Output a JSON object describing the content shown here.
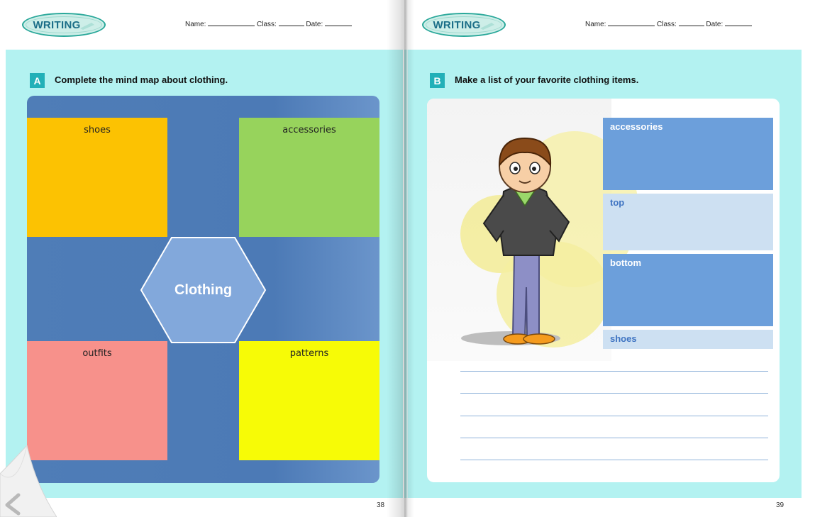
{
  "left_page": {
    "badge": "WRITING",
    "fields": {
      "name": "Name:",
      "class": "Class:",
      "date": "Date:"
    },
    "section_letter": "A",
    "section_title": "Complete the mind map about clothing.",
    "mindmap": {
      "center": "Clothing",
      "boxes": [
        {
          "label": "shoes",
          "color": "#fcc202"
        },
        {
          "label": "accessories",
          "color": "#97d35c"
        },
        {
          "label": "outfits",
          "color": "#f7918b"
        },
        {
          "label": "patterns",
          "color": "#f7fb06"
        }
      ]
    },
    "page_number": "38"
  },
  "right_page": {
    "badge": "WRITING",
    "fields": {
      "name": "Name:",
      "class": "Class:",
      "date": "Date:"
    },
    "section_letter": "B",
    "section_title": "Make a list of your favorite clothing items.",
    "categories": [
      "accessories",
      "top",
      "bottom",
      "shoes"
    ],
    "writing_lines": 5,
    "page_number": "39"
  },
  "nav": {
    "prev_icon": "chevron-left-icon"
  },
  "colors": {
    "panel": "#b3f2f1",
    "accent": "#22b0b8",
    "mindmap_bg": "#4f7db7"
  }
}
